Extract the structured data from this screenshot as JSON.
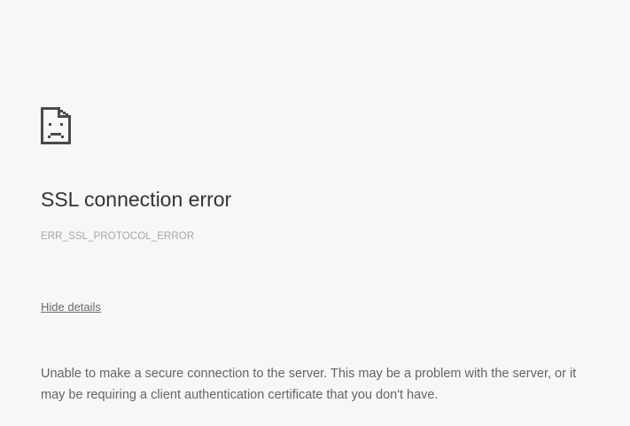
{
  "error": {
    "icon": "sad-page-icon",
    "title": "SSL connection error",
    "code": "ERR_SSL_PROTOCOL_ERROR",
    "details_button_label": "Hide details",
    "details_text": "Unable to make a secure connection to the server. This may be a problem with the server, or it may be requiring a client authentication certificate that you don't have."
  },
  "colors": {
    "background": "#f7f7f7",
    "title": "#333333",
    "code": "#a6a6a6",
    "link": "#696969",
    "body_text": "#646464",
    "icon": "#4a4a4a"
  }
}
